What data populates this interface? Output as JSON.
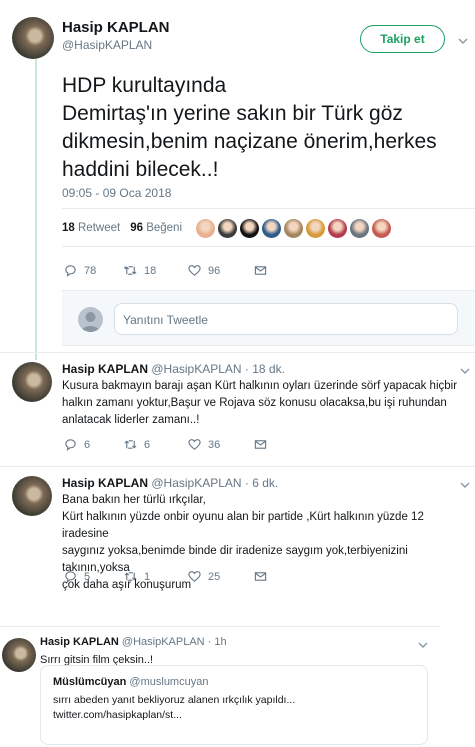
{
  "main": {
    "name": "Hasip KAPLAN",
    "handle": "@HasipKAPLAN",
    "follow_label": "Takip et",
    "text": "HDP kurultayında\nDemirtaş'ın yerine sakın  bir Türk göz\ndikmesin,benim naçizane önerim,herkes\nhaddini bilecek..!",
    "timestamp": "09:05 - 09 Oca 2018",
    "retweets_count": "18",
    "retweets_label": "Retweet",
    "likes_count": "96",
    "likes_label": "Beğeni",
    "reply_count": "78",
    "retweet_count_action": "18",
    "like_count_action": "96",
    "reply_placeholder": "Yanıtını Tweetle"
  },
  "replies": [
    {
      "name": "Hasip KAPLAN",
      "handle": "@HasipKAPLAN",
      "time": "· 18 dk.",
      "text": "Kusura bakmayın barajı aşan Kürt halkının oyları üzerinde sörf yapacak hiçbir\nhalkın zamanı yoktur,Başur ve Rojava söz konusu olacaksa,bu işi ruhundan\nanlatacak liderler zamanı..!",
      "replies": "6",
      "retweets": "6",
      "likes": "36"
    },
    {
      "name": "Hasip KAPLAN",
      "handle": "@HasipKAPLAN",
      "time": "· 6 dk.",
      "text": "Bana bakın her türlü ırkçılar,\nKürt halkının yüzde onbir oyunu alan bir partide ,Kürt halkının yüzde 12 iradesine\nsaygınız yoksa,benimde binde dir iradenize saygım yok,terbiyenizini takının,yoksa\nçok daha aşır konuşurum",
      "replies": "5",
      "retweets": "1",
      "likes": "25"
    },
    {
      "name": "Hasip KAPLAN",
      "handle": "@HasipKAPLAN",
      "time": "· 1h",
      "text": "Sırrı gitsin film çeksin..!"
    }
  ],
  "quoted": {
    "name": "Müslümcüyan",
    "handle": "@muslumcuyan",
    "text": "sırrı abeden yanıt bekliyoruz alanen ırkçılık yapıldı...\ntwitter.com/hasipkaplan/st..."
  },
  "colors": {
    "accent_green": "#1da063",
    "thread_line": "#c7e8d7",
    "muted": "#657786"
  },
  "likers": [
    "#e8b08f",
    "#3b3b3b",
    "#111111",
    "#2b5c8a",
    "#a3865c",
    "#d59a3a",
    "#b33b4b",
    "#6a7480",
    "#c65a4f"
  ]
}
